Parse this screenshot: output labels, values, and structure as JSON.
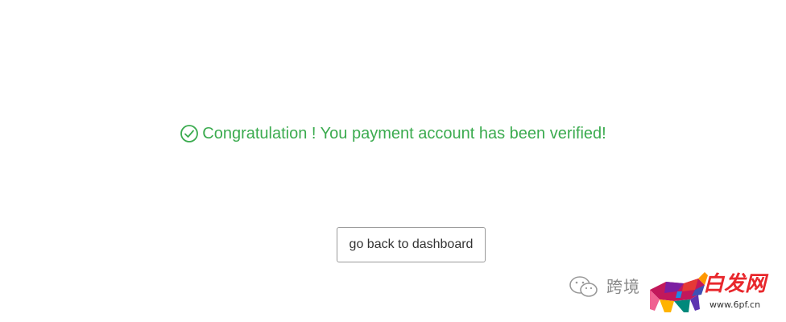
{
  "message": {
    "icon": "check-circle-icon",
    "text": "Congratulation ! You payment account has been verified!",
    "color": "#3bab4f"
  },
  "button": {
    "label": "go back to dashboard"
  },
  "watermark": {
    "icon": "wechat-icon",
    "text": "跨境",
    "brand": "白发网",
    "url": "www.6pf.cn"
  }
}
